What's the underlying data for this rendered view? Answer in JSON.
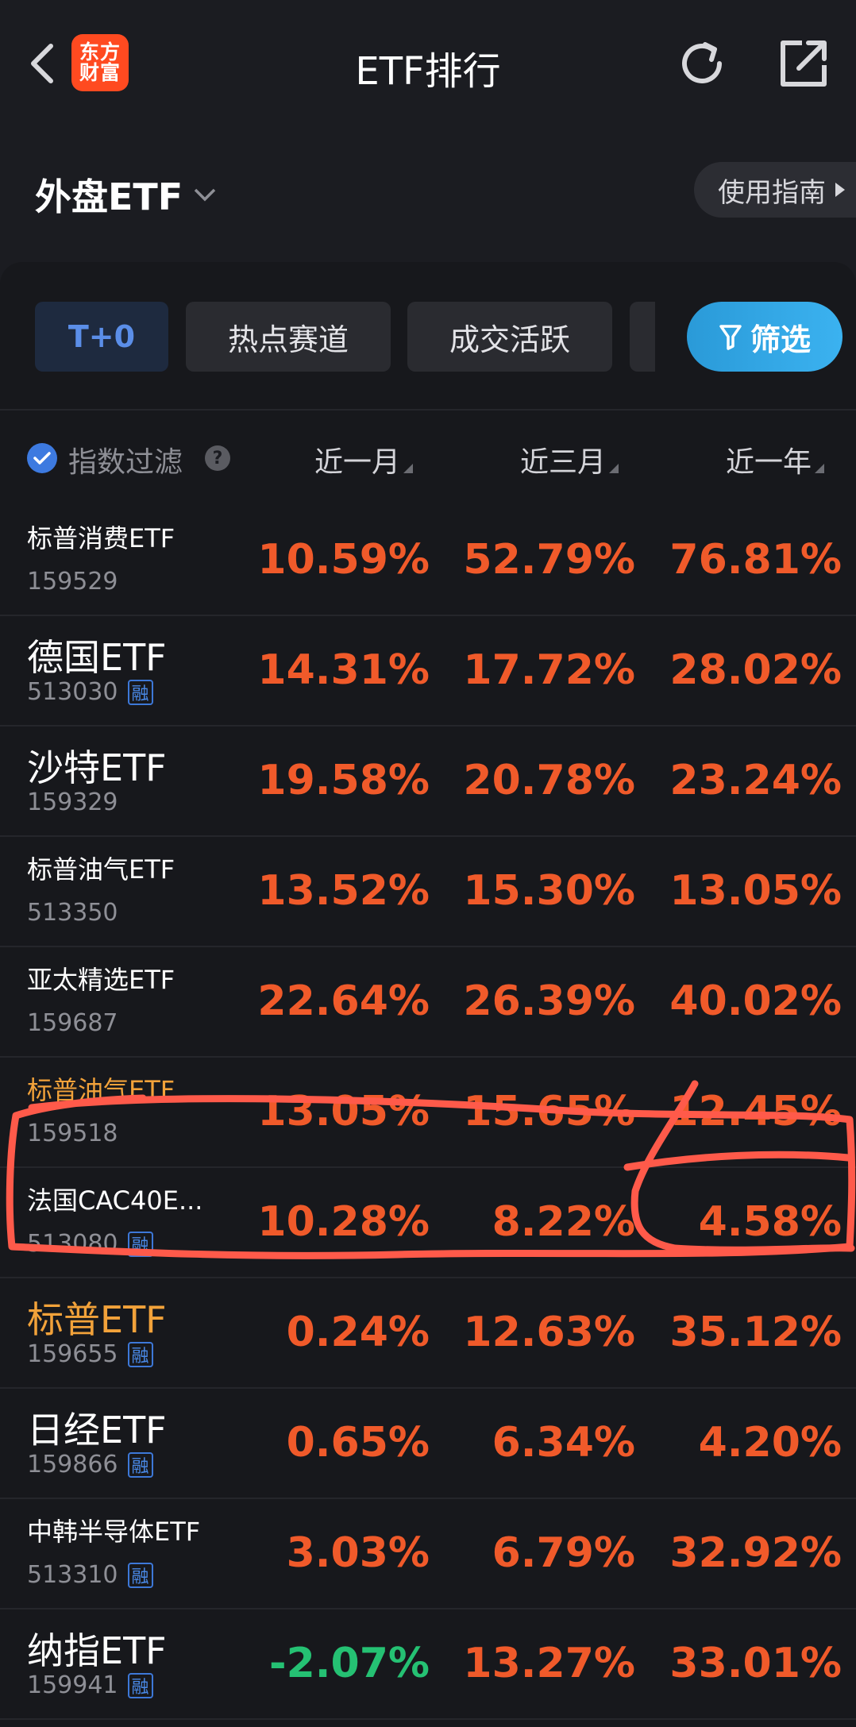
{
  "topbar": {
    "title": "ETF排行",
    "logo_line1": "东方",
    "logo_line2": "财富"
  },
  "market": {
    "label": "外盘ETF"
  },
  "guide": {
    "label": "使用指南"
  },
  "chips": [
    {
      "label": "T+0",
      "active": true
    },
    {
      "label": "热点赛道",
      "active": false
    },
    {
      "label": "成交活跃",
      "active": false
    }
  ],
  "filter": {
    "label": "筛选"
  },
  "table": {
    "filter_label": "指数过滤",
    "help": "?",
    "columns": [
      "近一月",
      "近三月",
      "近一年"
    ],
    "rows": [
      {
        "name": "标普消费ETF",
        "code": "159529",
        "margin": "",
        "m1": "10.59%",
        "m3": "52.79%",
        "y1": "76.81%"
      },
      {
        "name": "德国ETF",
        "code": "513030",
        "margin": "融",
        "m1": "14.31%",
        "m3": "17.72%",
        "y1": "28.02%"
      },
      {
        "name": "沙特ETF",
        "code": "159329",
        "margin": "",
        "m1": "19.58%",
        "m3": "20.78%",
        "y1": "23.24%"
      },
      {
        "name": "标普油气ETF",
        "code": "513350",
        "margin": "",
        "m1": "13.52%",
        "m3": "15.30%",
        "y1": "13.05%"
      },
      {
        "name": "亚太精选ETF",
        "code": "159687",
        "margin": "",
        "m1": "22.64%",
        "m3": "26.39%",
        "y1": "40.02%"
      },
      {
        "name": "标普油气ETF",
        "code": "159518",
        "margin": "",
        "m1": "13.05%",
        "m3": "15.65%",
        "y1": "12.45%"
      },
      {
        "name": "法国CAC40E...",
        "code": "513080",
        "margin": "融",
        "m1": "10.28%",
        "m3": "8.22%",
        "y1": "4.58%"
      },
      {
        "name": "标普ETF",
        "code": "159655",
        "margin": "融",
        "m1": "0.24%",
        "m3": "12.63%",
        "y1": "35.12%"
      },
      {
        "name": "日经ETF",
        "code": "159866",
        "margin": "融",
        "m1": "0.65%",
        "m3": "6.34%",
        "y1": "4.20%"
      },
      {
        "name": "中韩半导体ETF",
        "code": "513310",
        "margin": "融",
        "m1": "3.03%",
        "m3": "6.79%",
        "y1": "32.92%"
      },
      {
        "name": "纳指ETF",
        "code": "159941",
        "margin": "融",
        "m1": "-2.07%",
        "m3": "13.27%",
        "y1": "33.01%"
      }
    ]
  },
  "colors": {
    "up": "#f05a2a",
    "down": "#25c173",
    "accent": "#3bb2f0",
    "annotation": "#ff5a4a"
  }
}
